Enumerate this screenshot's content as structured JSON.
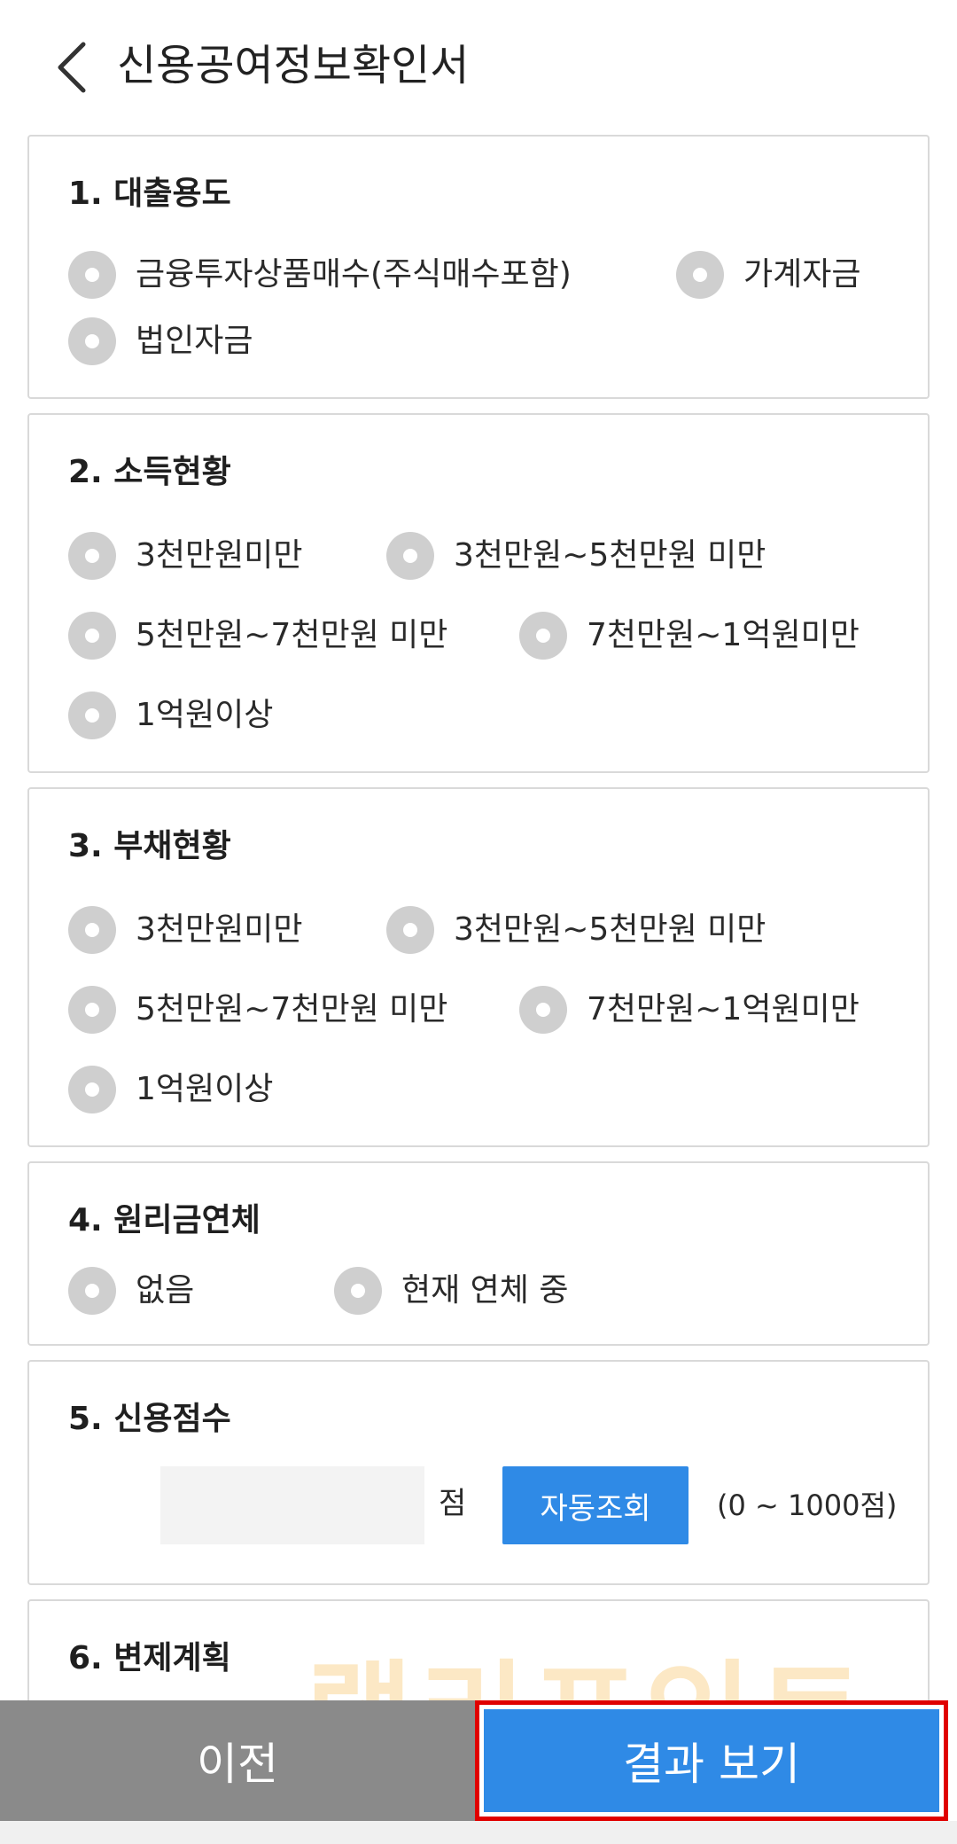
{
  "header": {
    "title": "신용공여정보확인서"
  },
  "sections": {
    "purpose": {
      "title": "1. 대출용도",
      "options": [
        "금융투자상품매수(주식매수포함)",
        "가계자금",
        "법인자금"
      ]
    },
    "income": {
      "title": "2. 소득현황",
      "options": [
        "3천만원미만",
        "3천만원~5천만원 미만",
        "5천만원~7천만원 미만",
        "7천만원~1억원미만",
        "1억원이상"
      ]
    },
    "debt": {
      "title": "3. 부채현황",
      "options": [
        "3천만원미만",
        "3천만원~5천만원 미만",
        "5천만원~7천만원 미만",
        "7천만원~1억원미만",
        "1억원이상"
      ]
    },
    "overdue": {
      "title": "4. 원리금연체",
      "options": [
        "없음",
        "현재 연체 중"
      ]
    },
    "credit_score": {
      "title": "5. 신용점수",
      "input_value": "",
      "unit": "점",
      "auto_button": "자동조회",
      "range": "(0 ~ 1000점)"
    },
    "repayment": {
      "title": "6. 변제계획"
    }
  },
  "watermark": "랠리포인트",
  "footer": {
    "prev_label": "이전",
    "result_label": "결과 보기"
  },
  "colors": {
    "accent_blue": "#2f8ae6",
    "prev_gray": "#8a8a8a",
    "highlight_red": "#e00000",
    "radio_gray": "#cfcfcf"
  }
}
